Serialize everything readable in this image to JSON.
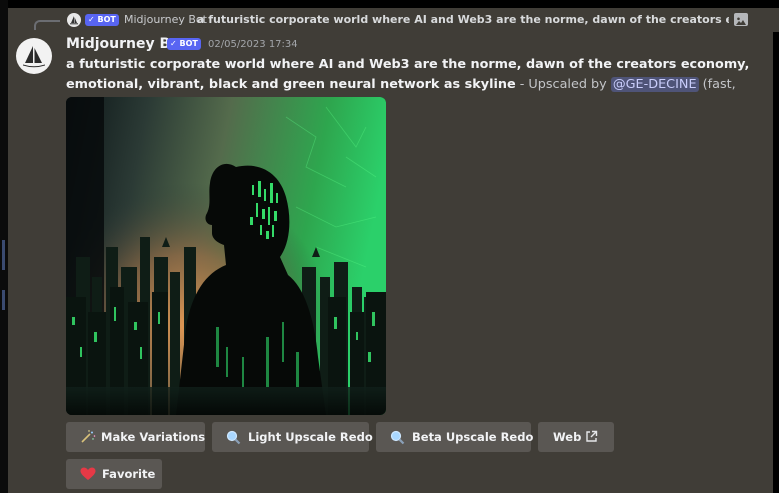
{
  "reply": {
    "author": "Midjourney Bot",
    "badge": "✓ BOT",
    "text": "a futuristic corporate world where AI and Web3 are the norme, dawn of the creators econon"
  },
  "message": {
    "author": "Midjourney Bot",
    "badge": "✓ BOT",
    "timestamp": "02/05/2023 17:34",
    "prompt": "a futuristic corporate world where AI and Web3 are the norme, dawn of the creators economy, emotional, vibrant, black and green neural network as skyline",
    "upscaled_prefix": " - Upscaled by ",
    "mention": "@GE-DECINE",
    "suffix": " (fast, stealth)"
  },
  "buttons": {
    "make_variations": "Make Variations",
    "light_upscale_redo": "Light Upscale Redo",
    "beta_upscale_redo": "Beta Upscale Redo",
    "web": "Web",
    "favorite": "Favorite"
  },
  "icons": {
    "make_variations": "magic-wand-icon",
    "light_upscale_redo": "magnifier-icon",
    "beta_upscale_redo": "magnifier-icon",
    "web": "external-link-icon",
    "favorite": "heart-icon",
    "reply_attachment": "image-icon"
  },
  "colors": {
    "background": "#403d37",
    "badge": "#5865f2",
    "button": "#5a5753",
    "mention_bg": "#4f5478",
    "heart": "#e63946"
  }
}
